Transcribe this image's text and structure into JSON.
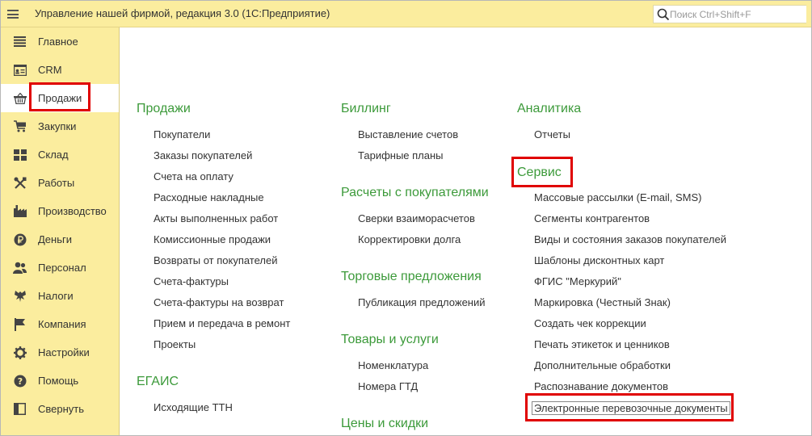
{
  "app": {
    "title": "Управление нашей фирмой, редакция 3.0  (1С:Предприятие)"
  },
  "search": {
    "placeholder": "Поиск Ctrl+Shift+F"
  },
  "sidebar": {
    "items": [
      {
        "label": "Главное",
        "icon": "list-icon"
      },
      {
        "label": "CRM",
        "icon": "crm-card-icon"
      },
      {
        "label": "Продажи",
        "icon": "basket-icon"
      },
      {
        "label": "Закупки",
        "icon": "cart-icon"
      },
      {
        "label": "Склад",
        "icon": "warehouse-icon"
      },
      {
        "label": "Работы",
        "icon": "tools-icon"
      },
      {
        "label": "Производство",
        "icon": "factory-icon"
      },
      {
        "label": "Деньги",
        "icon": "ruble-icon"
      },
      {
        "label": "Персонал",
        "icon": "people-icon"
      },
      {
        "label": "Налоги",
        "icon": "eagle-icon"
      },
      {
        "label": "Компания",
        "icon": "flag-icon"
      },
      {
        "label": "Настройки",
        "icon": "gear-icon"
      },
      {
        "label": "Помощь",
        "icon": "help-icon"
      },
      {
        "label": "Свернуть",
        "icon": "collapse-icon"
      }
    ],
    "active_index": 2
  },
  "sections": {
    "sales": {
      "title": "Продажи",
      "links": [
        "Покупатели",
        "Заказы покупателей",
        "Счета на оплату",
        "Расходные накладные",
        "Акты выполненных работ",
        "Комиссионные продажи",
        "Возвраты от покупателей",
        "Счета-фактуры",
        "Счета-фактуры на возврат",
        "Прием и передача в ремонт",
        "Проекты"
      ]
    },
    "egais": {
      "title": "ЕГАИС",
      "links": [
        "Исходящие ТТН"
      ]
    },
    "billing": {
      "title": "Биллинг",
      "links": [
        "Выставление счетов",
        "Тарифные планы"
      ]
    },
    "settlements": {
      "title": "Расчеты с покупателями",
      "links": [
        "Сверки взаиморасчетов",
        "Корректировки долга"
      ]
    },
    "offers": {
      "title": "Торговые предложения",
      "links": [
        "Публикация предложений"
      ]
    },
    "goods": {
      "title": "Товары и услуги",
      "links": [
        "Номенклатура",
        "Номера ГТД"
      ]
    },
    "prices": {
      "title": "Цены и скидки",
      "links": []
    },
    "analytics": {
      "title": "Аналитика",
      "links": [
        "Отчеты"
      ]
    },
    "service": {
      "title": "Сервис",
      "links": [
        "Массовые рассылки (E-mail, SMS)",
        "Сегменты контрагентов",
        "Виды и состояния заказов покупателей",
        "Шаблоны дисконтных карт",
        "ФГИС \"Меркурий\"",
        "Маркировка (Честный Знак)",
        "Создать чек коррекции",
        "Печать этикеток и ценников",
        "Дополнительные обработки",
        "Распознавание документов",
        "Электронные перевозочные документы"
      ]
    }
  },
  "colors": {
    "section_title": "#3c9a3a",
    "panel_bg": "#fbed9e",
    "highlight": "#e00000"
  }
}
